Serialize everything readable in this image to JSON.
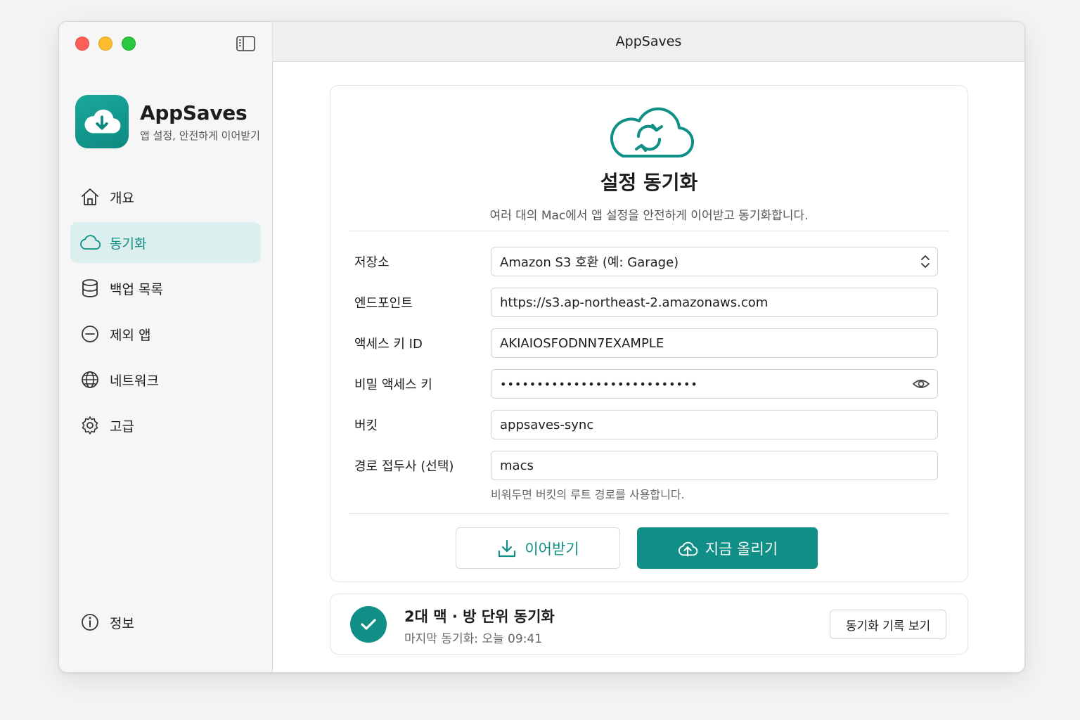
{
  "window": {
    "title": "AppSaves"
  },
  "brand": {
    "name": "AppSaves",
    "tagline": "앱 설정, 안전하게 이어받기"
  },
  "sidebar": {
    "items": [
      {
        "label": "개요",
        "icon": "home-icon",
        "active": false
      },
      {
        "label": "동기화",
        "icon": "cloud-icon",
        "active": true
      },
      {
        "label": "백업 목록",
        "icon": "database-icon",
        "active": false
      },
      {
        "label": "제외 앱",
        "icon": "minus-circle-icon",
        "active": false
      },
      {
        "label": "네트워크",
        "icon": "globe-icon",
        "active": false
      },
      {
        "label": "고급",
        "icon": "gear-icon",
        "active": false
      }
    ],
    "info": {
      "label": "정보",
      "icon": "info-icon"
    }
  },
  "sync": {
    "title": "설정 동기화",
    "subtitle": "여러 대의 Mac에서 앱 설정을 안전하게 이어받고 동기화합니다.",
    "fields": {
      "storage": {
        "label": "저장소",
        "value": "Amazon S3 호환 (예: Garage)"
      },
      "endpoint": {
        "label": "엔드포인트",
        "value": "https://s3.ap-northeast-2.amazonaws.com"
      },
      "access_key": {
        "label": "액세스 키 ID",
        "value": "AKIAIOSFODNN7EXAMPLE"
      },
      "secret_key": {
        "label": "비밀 액세스 키",
        "value": "•••••••••••••••••••••••••••"
      },
      "bucket": {
        "label": "버킷",
        "value": "appsaves-sync"
      },
      "prefix": {
        "label": "경로 접두사 (선택)",
        "value": "macs",
        "hint": "비워두면 버킷의 루트 경로를 사용합니다."
      }
    },
    "buttons": {
      "pull": "이어받기",
      "push": "지금 올리기"
    }
  },
  "status": {
    "title": "2대 맥 · 방 단위 동기화",
    "subtitle": "마지막 동기화: 오늘 09:41",
    "history_button": "동기화 기록 보기"
  },
  "colors": {
    "accent": "#0f8f86",
    "accent_soft": "#dcefee"
  }
}
